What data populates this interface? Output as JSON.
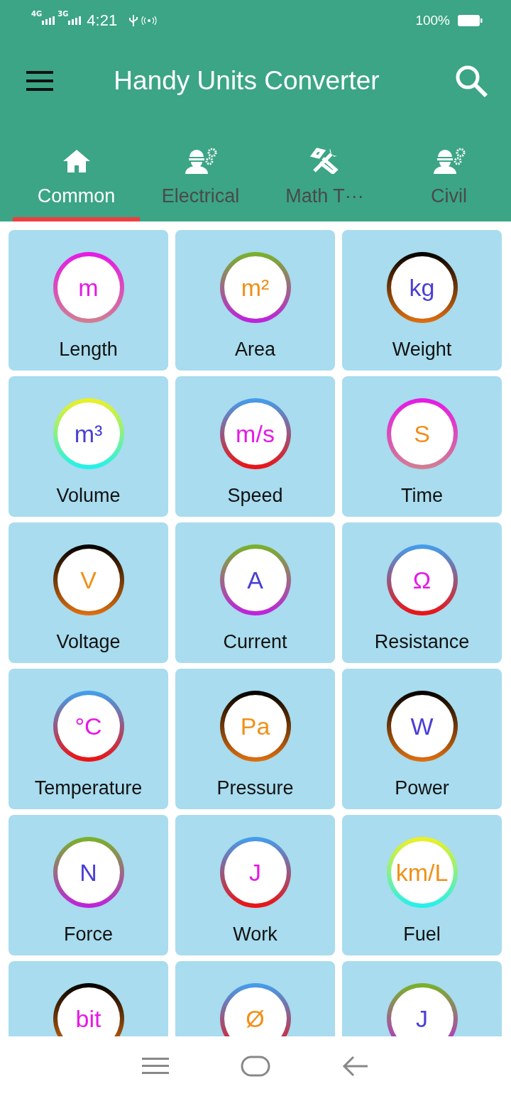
{
  "status_bar": {
    "net1": "4G",
    "net2": "3G",
    "time": "4:21",
    "battery": "100%"
  },
  "app_bar": {
    "title": "Handy Units Converter"
  },
  "tabs": [
    {
      "label": "Common",
      "kind": "home",
      "selected": true
    },
    {
      "label": "Electrical",
      "kind": "engineer",
      "selected": false
    },
    {
      "label": "Math T···",
      "kind": "tools",
      "selected": false
    },
    {
      "label": "Civil",
      "kind": "engineer",
      "selected": false
    }
  ],
  "units": [
    {
      "symbol": "m",
      "label": "Length",
      "color": "#e619e6"
    },
    {
      "symbol": "m²",
      "label": "Area",
      "color": "#f0901a"
    },
    {
      "symbol": "kg",
      "label": "Weight",
      "color": "#4a3fd6"
    },
    {
      "symbol": "m³",
      "label": "Volume",
      "color": "#4a3fd6"
    },
    {
      "symbol": "m/s",
      "label": "Speed",
      "color": "#e619e6"
    },
    {
      "symbol": "S",
      "label": "Time",
      "color": "#f0901a"
    },
    {
      "symbol": "V",
      "label": "Voltage",
      "color": "#f0901a"
    },
    {
      "symbol": "A",
      "label": "Current",
      "color": "#4a3fd6"
    },
    {
      "symbol": "Ω",
      "label": "Resistance",
      "color": "#e619e6"
    },
    {
      "symbol": "°C",
      "label": "Temperature",
      "color": "#e619e6"
    },
    {
      "symbol": "Pa",
      "label": "Pressure",
      "color": "#f0901a"
    },
    {
      "symbol": "W",
      "label": "Power",
      "color": "#4a3fd6"
    },
    {
      "symbol": "N",
      "label": "Force",
      "color": "#4a3fd6"
    },
    {
      "symbol": "J",
      "label": "Work",
      "color": "#e619e6"
    },
    {
      "symbol": "km/L",
      "label": "Fuel",
      "color": "#f0901a"
    },
    {
      "symbol": "bit",
      "color": "#e619e6"
    },
    {
      "symbol": "Ø",
      "color": "#f0901a"
    },
    {
      "symbol": "J",
      "color": "#4a3fd6"
    }
  ]
}
